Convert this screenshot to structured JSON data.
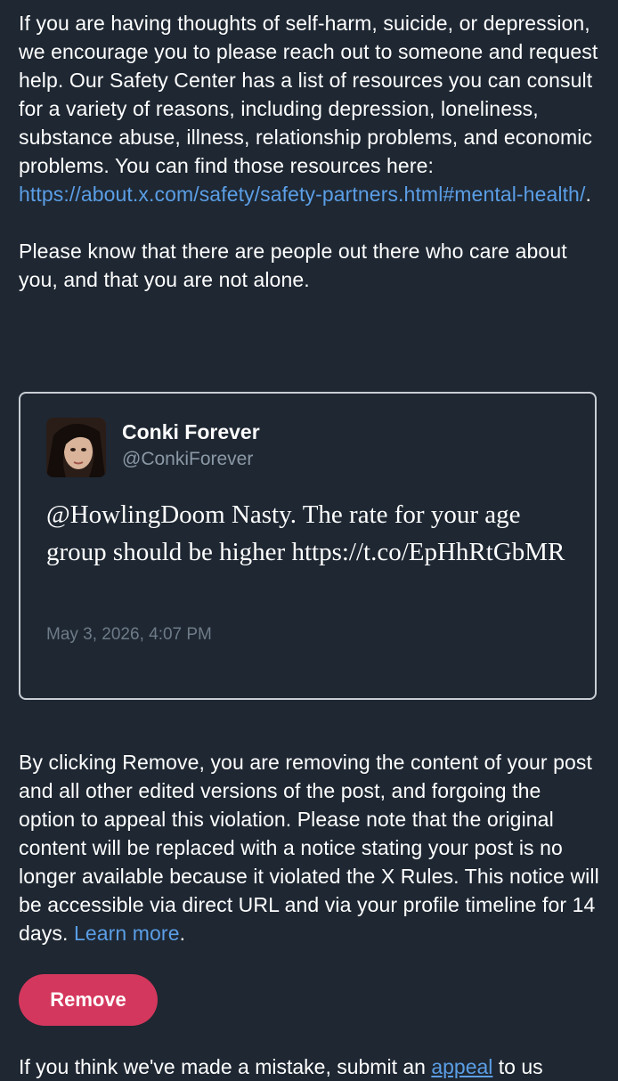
{
  "intro": {
    "paragraph1": "If you are having thoughts of self-harm, suicide, or depression, we encourage you to please reach out to someone and request help. Our Safety Center has a list of resources you can consult for a variety of reasons, including depression, loneliness, substance abuse, illness, relationship problems, and economic problems. You can find those resources here: ",
    "resources_link": "https://about.x.com/safety/safety-partners.html#mental-health/",
    "paragraph1_end": ".",
    "paragraph2": "Please know that there are people out there who care about you, and that you are not alone."
  },
  "tweet": {
    "author_name": "Conki Forever",
    "author_handle": "@ConkiForever",
    "text": "@HowlingDoom Nasty. The rate for your age group should be higher https://t.co/EpHhRtGbMR",
    "timestamp": "May 3, 2026, 4:07 PM"
  },
  "removal": {
    "text": "By clicking Remove, you are removing the content of your post and all other edited versions of the post, and forgoing the option to appeal this violation. Please note that the original content will be replaced with a notice stating your post is no longer available because it violated the X Rules. This notice will be accessible via direct URL and via your profile timeline for 14 days. ",
    "learn_more": "Learn more",
    "text_end": ".",
    "remove_label": "Remove"
  },
  "footer": {
    "text_start": "If you think we've made a mistake, submit an ",
    "appeal_link": "appeal",
    "text_end": " to us"
  },
  "colors": {
    "background": "#1e2732",
    "link": "#5b9ee6",
    "remove_button": "#d4375d"
  }
}
